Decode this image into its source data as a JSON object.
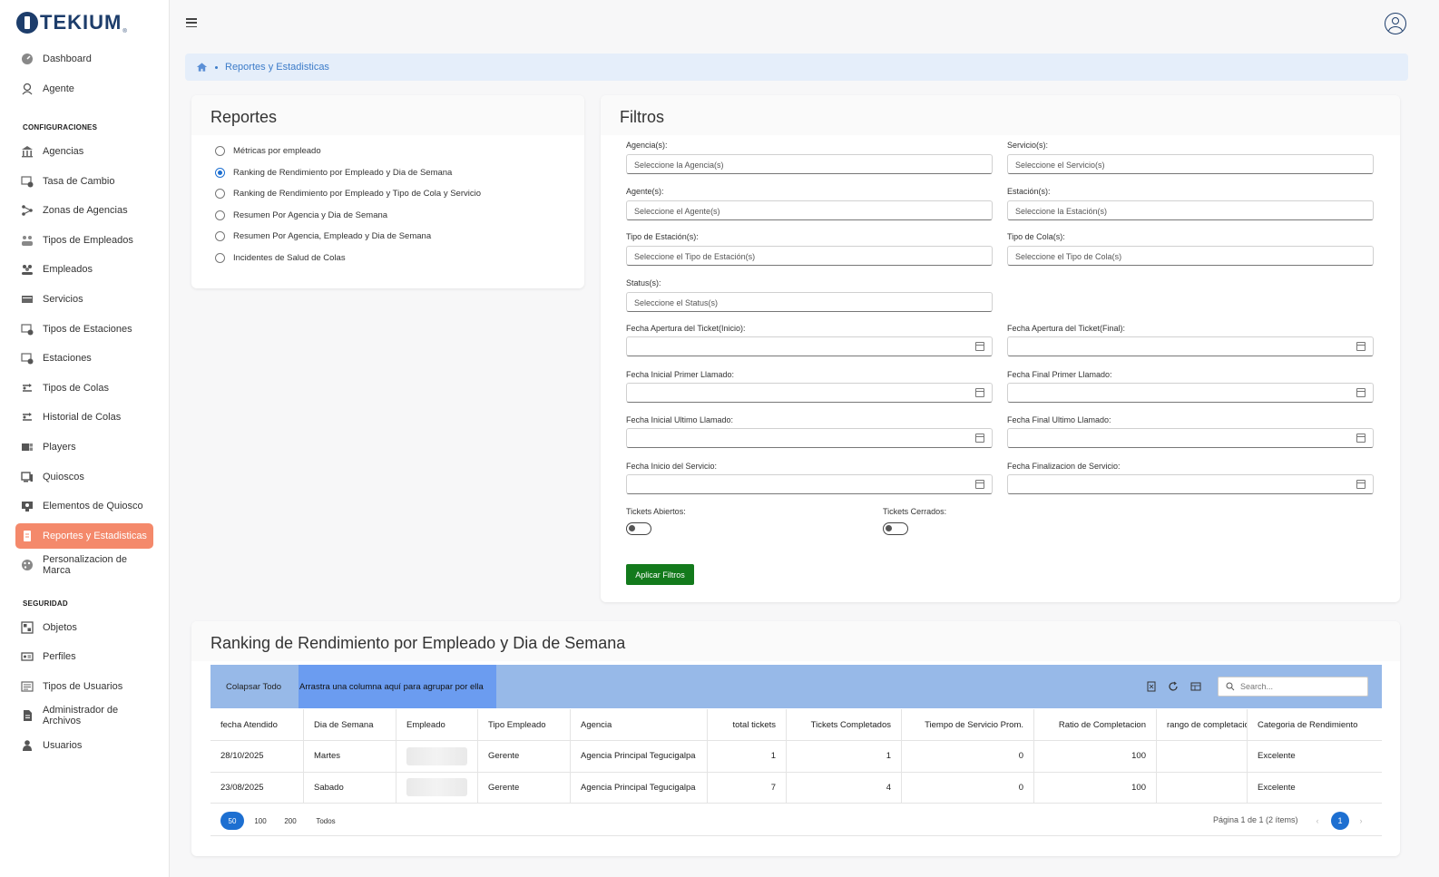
{
  "app": {
    "logo_text": "TEKIUM",
    "logo_mark": "®"
  },
  "sidebar": {
    "top_items": [
      {
        "label": "Dashboard",
        "icon": "dashboard-icon"
      },
      {
        "label": "Agente",
        "icon": "agent-icon"
      }
    ],
    "config_title": "CONFIGURACIONES",
    "config_items": [
      {
        "label": "Agencias",
        "icon": "bank-icon"
      },
      {
        "label": "Tasa de Cambio",
        "icon": "exchange-icon"
      },
      {
        "label": "Zonas de Agencias",
        "icon": "zones-icon"
      },
      {
        "label": "Tipos de Empleados",
        "icon": "employee-types-icon"
      },
      {
        "label": "Empleados",
        "icon": "employees-icon"
      },
      {
        "label": "Servicios",
        "icon": "services-icon"
      },
      {
        "label": "Tipos de Estaciones",
        "icon": "station-types-icon"
      },
      {
        "label": "Estaciones",
        "icon": "stations-icon"
      },
      {
        "label": "Tipos de Colas",
        "icon": "queue-types-icon"
      },
      {
        "label": "Historial de Colas",
        "icon": "queue-history-icon"
      },
      {
        "label": "Players",
        "icon": "players-icon"
      },
      {
        "label": "Quioscos",
        "icon": "kiosk-icon"
      },
      {
        "label": "Elementos de Quiosco",
        "icon": "kiosk-elements-icon"
      },
      {
        "label": "Reportes y Estadisticas",
        "icon": "reports-icon",
        "active": true
      },
      {
        "label": "Personalizacion de Marca",
        "icon": "branding-icon"
      }
    ],
    "security_title": "SEGURIDAD",
    "security_items": [
      {
        "label": "Objetos",
        "icon": "objects-icon"
      },
      {
        "label": "Perfiles",
        "icon": "profiles-icon"
      },
      {
        "label": "Tipos de Usuarios",
        "icon": "user-types-icon"
      },
      {
        "label": "Administrador de Archivos",
        "icon": "file-manager-icon"
      },
      {
        "label": "Usuarios",
        "icon": "users-icon"
      }
    ]
  },
  "breadcrumb": {
    "current": "Reportes y Estadisticas"
  },
  "reports": {
    "title": "Reportes",
    "options": [
      {
        "label": "Métricas por empleado",
        "checked": false
      },
      {
        "label": "Ranking de Rendimiento por Empleado y Dia de Semana",
        "checked": true
      },
      {
        "label": "Ranking de Rendimiento por Empleado y Tipo de Cola y Servicio",
        "checked": false
      },
      {
        "label": "Resumen Por Agencia y Dia de Semana",
        "checked": false
      },
      {
        "label": "Resumen Por Agencia, Empleado y Dia de Semana",
        "checked": false
      },
      {
        "label": "Incidentes de Salud de Colas",
        "checked": false
      }
    ]
  },
  "filters": {
    "title": "Filtros",
    "selects": [
      {
        "label": "Agencia(s):",
        "placeholder": "Seleccione la Agencia(s)"
      },
      {
        "label": "Servicio(s):",
        "placeholder": "Seleccione el Servicio(s)"
      },
      {
        "label": "Agente(s):",
        "placeholder": "Seleccione el Agente(s)"
      },
      {
        "label": "Estación(s):",
        "placeholder": "Seleccione la Estación(s)"
      },
      {
        "label": "Tipo de Estación(s):",
        "placeholder": "Seleccione el Tipo de Estación(s)"
      },
      {
        "label": "Tipo de Cola(s):",
        "placeholder": "Seleccione el Tipo de Cola(s)"
      },
      {
        "label": "Status(s):",
        "placeholder": "Seleccione el Status(s)"
      }
    ],
    "dates": [
      {
        "label": "Fecha Apertura del Ticket(Inicio):"
      },
      {
        "label": "Fecha Apertura del Ticket(Final):"
      },
      {
        "label": "Fecha Inicial Primer Llamado:"
      },
      {
        "label": "Fecha Final Primer Llamado:"
      },
      {
        "label": "Fecha Inicial Ultimo Llamado:"
      },
      {
        "label": "Fecha Final Ultimo Llamado:"
      },
      {
        "label": "Fecha Inicio del Servicio:"
      },
      {
        "label": "Fecha Finalizacion de Servicio:"
      }
    ],
    "toggles": [
      {
        "label": "Tickets Abiertos:",
        "on": false
      },
      {
        "label": "Tickets Cerrados:",
        "on": false
      }
    ],
    "apply_label": "Aplicar Filtros"
  },
  "ranking": {
    "title": "Ranking de Rendimiento por Empleado y Dia de Semana",
    "collapse_label": "Colapsar Todo",
    "group_hint": "Arrastra una columna aquí para agrupar por ella",
    "search_placeholder": "Search...",
    "columns": [
      "fecha Atendido",
      "Dia de Semana",
      "Empleado",
      "Tipo Empleado",
      "Agencia",
      "total tickets",
      "Tickets Completados",
      "Tiempo de Servicio Prom.",
      "Ratio de Completacion",
      "rango de completacion",
      "Categoria de Rendimiento"
    ],
    "rows": [
      [
        "28/10/2025",
        "Martes",
        "",
        "Gerente",
        "Agencia Principal Tegucigalpa",
        "1",
        "1",
        "0",
        "100",
        "",
        "Excelente"
      ],
      [
        "23/08/2025",
        "Sabado",
        "",
        "Gerente",
        "Agencia Principal Tegucigalpa",
        "7",
        "4",
        "0",
        "100",
        "",
        "Excelente"
      ]
    ],
    "page_sizes": [
      "50",
      "100",
      "200",
      "Todos"
    ],
    "page_info": "Página 1 de 1 (2 ítems)",
    "current_page": "1"
  }
}
